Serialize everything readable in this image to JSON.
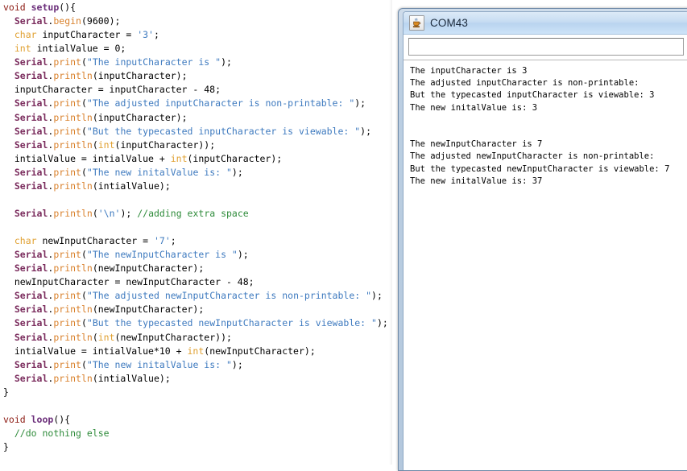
{
  "editor": {
    "name": "arduino-code-editor",
    "language": "arduino-c",
    "lines": [
      [
        {
          "t": "void ",
          "c": "kw"
        },
        {
          "t": "setup",
          "c": "fn"
        },
        {
          "t": "(){",
          "c": "plain"
        }
      ],
      [
        {
          "t": "  ",
          "c": "plain"
        },
        {
          "t": "Serial",
          "c": "obj"
        },
        {
          "t": ".",
          "c": "plain"
        },
        {
          "t": "begin",
          "c": "method"
        },
        {
          "t": "(9600);",
          "c": "plain"
        }
      ],
      [
        {
          "t": "  ",
          "c": "plain"
        },
        {
          "t": "char",
          "c": "type"
        },
        {
          "t": " inputCharacter = ",
          "c": "plain"
        },
        {
          "t": "'3'",
          "c": "str"
        },
        {
          "t": ";",
          "c": "plain"
        }
      ],
      [
        {
          "t": "  ",
          "c": "plain"
        },
        {
          "t": "int",
          "c": "type"
        },
        {
          "t": " intialValue = 0;",
          "c": "plain"
        }
      ],
      [
        {
          "t": "  ",
          "c": "plain"
        },
        {
          "t": "Serial",
          "c": "obj"
        },
        {
          "t": ".",
          "c": "plain"
        },
        {
          "t": "print",
          "c": "method"
        },
        {
          "t": "(",
          "c": "plain"
        },
        {
          "t": "\"The inputCharacter is \"",
          "c": "str"
        },
        {
          "t": ");",
          "c": "plain"
        }
      ],
      [
        {
          "t": "  ",
          "c": "plain"
        },
        {
          "t": "Serial",
          "c": "obj"
        },
        {
          "t": ".",
          "c": "plain"
        },
        {
          "t": "println",
          "c": "method"
        },
        {
          "t": "(inputCharacter);",
          "c": "plain"
        }
      ],
      [
        {
          "t": "  inputCharacter = inputCharacter - 48;",
          "c": "plain"
        }
      ],
      [
        {
          "t": "  ",
          "c": "plain"
        },
        {
          "t": "Serial",
          "c": "obj"
        },
        {
          "t": ".",
          "c": "plain"
        },
        {
          "t": "print",
          "c": "method"
        },
        {
          "t": "(",
          "c": "plain"
        },
        {
          "t": "\"The adjusted inputCharacter is non-printable: \"",
          "c": "str"
        },
        {
          "t": ");",
          "c": "plain"
        }
      ],
      [
        {
          "t": "  ",
          "c": "plain"
        },
        {
          "t": "Serial",
          "c": "obj"
        },
        {
          "t": ".",
          "c": "plain"
        },
        {
          "t": "println",
          "c": "method"
        },
        {
          "t": "(inputCharacter);",
          "c": "plain"
        }
      ],
      [
        {
          "t": "  ",
          "c": "plain"
        },
        {
          "t": "Serial",
          "c": "obj"
        },
        {
          "t": ".",
          "c": "plain"
        },
        {
          "t": "print",
          "c": "method"
        },
        {
          "t": "(",
          "c": "plain"
        },
        {
          "t": "\"But the typecasted inputCharacter is viewable: \"",
          "c": "str"
        },
        {
          "t": ");",
          "c": "plain"
        }
      ],
      [
        {
          "t": "  ",
          "c": "plain"
        },
        {
          "t": "Serial",
          "c": "obj"
        },
        {
          "t": ".",
          "c": "plain"
        },
        {
          "t": "println",
          "c": "method"
        },
        {
          "t": "(",
          "c": "plain"
        },
        {
          "t": "int",
          "c": "type"
        },
        {
          "t": "(inputCharacter));",
          "c": "plain"
        }
      ],
      [
        {
          "t": "  intialValue = intialValue + ",
          "c": "plain"
        },
        {
          "t": "int",
          "c": "type"
        },
        {
          "t": "(inputCharacter);",
          "c": "plain"
        }
      ],
      [
        {
          "t": "  ",
          "c": "plain"
        },
        {
          "t": "Serial",
          "c": "obj"
        },
        {
          "t": ".",
          "c": "plain"
        },
        {
          "t": "print",
          "c": "method"
        },
        {
          "t": "(",
          "c": "plain"
        },
        {
          "t": "\"The new initalValue is: \"",
          "c": "str"
        },
        {
          "t": ");",
          "c": "plain"
        }
      ],
      [
        {
          "t": "  ",
          "c": "plain"
        },
        {
          "t": "Serial",
          "c": "obj"
        },
        {
          "t": ".",
          "c": "plain"
        },
        {
          "t": "println",
          "c": "method"
        },
        {
          "t": "(intialValue);",
          "c": "plain"
        }
      ],
      [
        {
          "t": "",
          "c": "plain"
        }
      ],
      [
        {
          "t": "  ",
          "c": "plain"
        },
        {
          "t": "Serial",
          "c": "obj"
        },
        {
          "t": ".",
          "c": "plain"
        },
        {
          "t": "println",
          "c": "method"
        },
        {
          "t": "(",
          "c": "plain"
        },
        {
          "t": "'\\n'",
          "c": "str"
        },
        {
          "t": "); ",
          "c": "plain"
        },
        {
          "t": "//adding extra space",
          "c": "cmt"
        }
      ],
      [
        {
          "t": "",
          "c": "plain"
        }
      ],
      [
        {
          "t": "  ",
          "c": "plain"
        },
        {
          "t": "char",
          "c": "type"
        },
        {
          "t": " newInputCharacter = ",
          "c": "plain"
        },
        {
          "t": "'7'",
          "c": "str"
        },
        {
          "t": ";",
          "c": "plain"
        }
      ],
      [
        {
          "t": "  ",
          "c": "plain"
        },
        {
          "t": "Serial",
          "c": "obj"
        },
        {
          "t": ".",
          "c": "plain"
        },
        {
          "t": "print",
          "c": "method"
        },
        {
          "t": "(",
          "c": "plain"
        },
        {
          "t": "\"The newInputCharacter is \"",
          "c": "str"
        },
        {
          "t": ");",
          "c": "plain"
        }
      ],
      [
        {
          "t": "  ",
          "c": "plain"
        },
        {
          "t": "Serial",
          "c": "obj"
        },
        {
          "t": ".",
          "c": "plain"
        },
        {
          "t": "println",
          "c": "method"
        },
        {
          "t": "(newInputCharacter);",
          "c": "plain"
        }
      ],
      [
        {
          "t": "  newInputCharacter = newInputCharacter - 48;",
          "c": "plain"
        }
      ],
      [
        {
          "t": "  ",
          "c": "plain"
        },
        {
          "t": "Serial",
          "c": "obj"
        },
        {
          "t": ".",
          "c": "plain"
        },
        {
          "t": "print",
          "c": "method"
        },
        {
          "t": "(",
          "c": "plain"
        },
        {
          "t": "\"The adjusted newInputCharacter is non-printable: \"",
          "c": "str"
        },
        {
          "t": ");",
          "c": "plain"
        }
      ],
      [
        {
          "t": "  ",
          "c": "plain"
        },
        {
          "t": "Serial",
          "c": "obj"
        },
        {
          "t": ".",
          "c": "plain"
        },
        {
          "t": "println",
          "c": "method"
        },
        {
          "t": "(newInputCharacter);",
          "c": "plain"
        }
      ],
      [
        {
          "t": "  ",
          "c": "plain"
        },
        {
          "t": "Serial",
          "c": "obj"
        },
        {
          "t": ".",
          "c": "plain"
        },
        {
          "t": "print",
          "c": "method"
        },
        {
          "t": "(",
          "c": "plain"
        },
        {
          "t": "\"But the typecasted newInputCharacter is viewable: \"",
          "c": "str"
        },
        {
          "t": ");",
          "c": "plain"
        }
      ],
      [
        {
          "t": "  ",
          "c": "plain"
        },
        {
          "t": "Serial",
          "c": "obj"
        },
        {
          "t": ".",
          "c": "plain"
        },
        {
          "t": "println",
          "c": "method"
        },
        {
          "t": "(",
          "c": "plain"
        },
        {
          "t": "int",
          "c": "type"
        },
        {
          "t": "(newInputCharacter));",
          "c": "plain"
        }
      ],
      [
        {
          "t": "  intialValue = intialValue*10 + ",
          "c": "plain"
        },
        {
          "t": "int",
          "c": "type"
        },
        {
          "t": "(newInputCharacter);",
          "c": "plain"
        }
      ],
      [
        {
          "t": "  ",
          "c": "plain"
        },
        {
          "t": "Serial",
          "c": "obj"
        },
        {
          "t": ".",
          "c": "plain"
        },
        {
          "t": "print",
          "c": "method"
        },
        {
          "t": "(",
          "c": "plain"
        },
        {
          "t": "\"The new initalValue is: \"",
          "c": "str"
        },
        {
          "t": ");",
          "c": "plain"
        }
      ],
      [
        {
          "t": "  ",
          "c": "plain"
        },
        {
          "t": "Serial",
          "c": "obj"
        },
        {
          "t": ".",
          "c": "plain"
        },
        {
          "t": "println",
          "c": "method"
        },
        {
          "t": "(intialValue);",
          "c": "plain"
        }
      ],
      [
        {
          "t": "}",
          "c": "plain"
        }
      ],
      [
        {
          "t": "",
          "c": "plain"
        }
      ],
      [
        {
          "t": "void ",
          "c": "kw"
        },
        {
          "t": "loop",
          "c": "fn"
        },
        {
          "t": "(){",
          "c": "plain"
        }
      ],
      [
        {
          "t": "  ",
          "c": "plain"
        },
        {
          "t": "//do nothing else",
          "c": "cmt"
        }
      ],
      [
        {
          "t": "}",
          "c": "plain"
        }
      ]
    ]
  },
  "serial_monitor": {
    "window_title": "COM43",
    "title_icon": "java-coffee-cup-icon",
    "send_input": {
      "value": "",
      "placeholder": ""
    },
    "output_lines": [
      "The inputCharacter is 3",
      "The adjusted inputCharacter is non-printable:",
      "But the typecasted inputCharacter is viewable: 3",
      "The new initalValue is: 3",
      "",
      "",
      "The newInputCharacter is 7",
      "The adjusted newInputCharacter is non-printable:",
      "But the typecasted newInputCharacter is viewable: 7",
      "The new initalValue is: 37"
    ]
  },
  "colors": {
    "keyword": "#8C1A12",
    "function_name": "#6B2E7A",
    "serial_object": "#7B2D5E",
    "method": "#D9812C",
    "datatype": "#E0A030",
    "string_literal": "#3E7ABF",
    "comment": "#2E8B3A",
    "titlebar_accent": "#b9d4ef"
  }
}
